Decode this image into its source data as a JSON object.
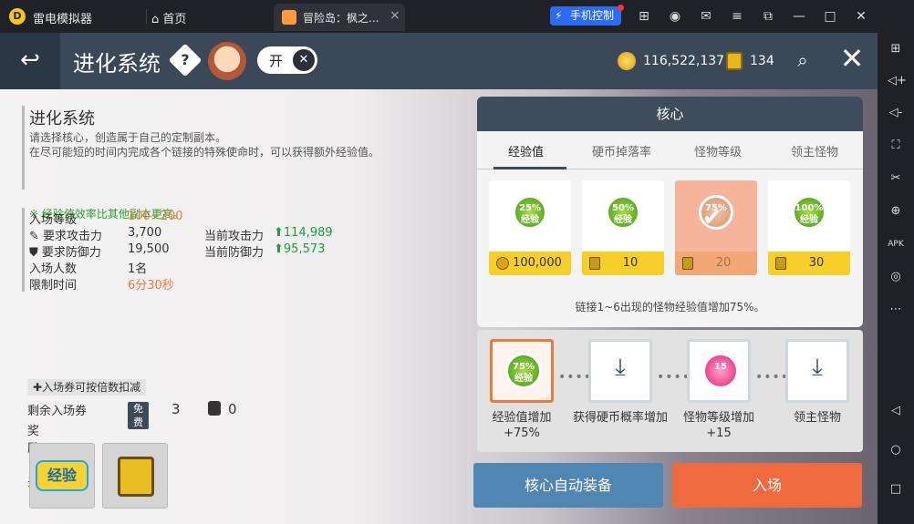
{
  "emulator": {
    "app_name": "雷电模拟器",
    "home_label": "首页",
    "tab_title": "冒险岛：枫之...",
    "phone_control": "手机控制"
  },
  "header": {
    "title": "进化系统",
    "help_symbol": "?",
    "toggle_label": "开",
    "meso": "116,522,137",
    "gems": "134"
  },
  "info": {
    "heading": "进化系统",
    "desc1": "请选择核心，创造属于自己的定制副本。",
    "desc2": "在尽可能短的时间内完成各个链接的特殊使命时，可以获得额外经验值。",
    "note": "※ 经验值效率比其他副本更高。"
  },
  "stats": {
    "entry_level_label": "入场等级",
    "entry_level_value": "100~200",
    "req_atk_label": "要求攻击力",
    "req_atk_value": "3,700",
    "cur_atk_label": "当前攻击力",
    "cur_atk_value": "114,989",
    "req_def_label": "要求防御力",
    "req_def_value": "19,500",
    "cur_def_label": "当前防御力",
    "cur_def_value": "95,573",
    "players_label": "入场人数",
    "players_value": "1名",
    "time_label": "限制时间",
    "time_value": "6分30秒"
  },
  "entry": {
    "hint": "入场券可按倍数扣减",
    "remain_label": "剩余入场券",
    "free_badge": "免费",
    "free_count": "3",
    "ticket_count": "0",
    "reward_label": "奖励目录"
  },
  "core": {
    "title": "核心",
    "tabs": [
      "经验值",
      "硬币掉落率",
      "怪物等级",
      "领主怪物"
    ],
    "cards": [
      {
        "badge": "25% 经验",
        "price": "100,000"
      },
      {
        "badge": "50% 经验",
        "price": "10"
      },
      {
        "badge": "75%",
        "price": "20"
      },
      {
        "badge": "100% 经验",
        "price": "30"
      }
    ],
    "description": "链接1~6出现的怪物经验值增加75%。"
  },
  "slots": [
    {
      "badge": "75% 经验",
      "label1": "经验值增加",
      "label2": "+75%"
    },
    {
      "label1": "获得硬币概率增加",
      "label2": ""
    },
    {
      "badge": "15",
      "label1": "怪物等级增加",
      "label2": "+15"
    },
    {
      "label1": "领主怪物",
      "label2": ""
    }
  ],
  "buttons": {
    "auto_equip": "核心自动装备",
    "enter": "入场"
  },
  "reward_items": [
    {
      "icon": "exp-scroll-icon",
      "text": "经验"
    },
    {
      "icon": "gem-coin-icon"
    }
  ],
  "colors": {
    "header_bg": "#3a4858",
    "accent_orange": "#ef6a3e",
    "accent_blue": "#4f86b2",
    "price_yellow": "#f7cf2a"
  }
}
